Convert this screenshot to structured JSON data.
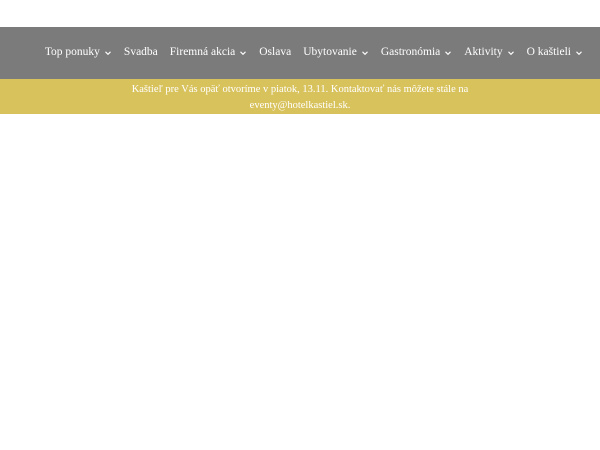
{
  "colors": {
    "navbar_bg": "#7b7b7b",
    "notice_bg": "#d8c25c",
    "nav_text": "#ffffff",
    "notice_text": "#ffffff",
    "page_bg": "#ffffff"
  },
  "nav": {
    "items": [
      {
        "label": "Top ponuky",
        "has_dropdown": true
      },
      {
        "label": "Svadba",
        "has_dropdown": false
      },
      {
        "label": "Firemná akcia",
        "has_dropdown": true
      },
      {
        "label": "Oslava",
        "has_dropdown": false
      },
      {
        "label": "Ubytovanie",
        "has_dropdown": true
      },
      {
        "label": "Gastronómia",
        "has_dropdown": true
      },
      {
        "label": "Aktivity",
        "has_dropdown": true
      },
      {
        "label": "O kaštieli",
        "has_dropdown": true
      }
    ],
    "dropdown_icon": "chevron-down-icon"
  },
  "notice": {
    "line1": "Kaštieľ pre Vás opäť otvoríme v piatok, 13.11. Kontaktovať nás môžete stále na",
    "line2": "eventy@hotelkastiel.sk."
  }
}
